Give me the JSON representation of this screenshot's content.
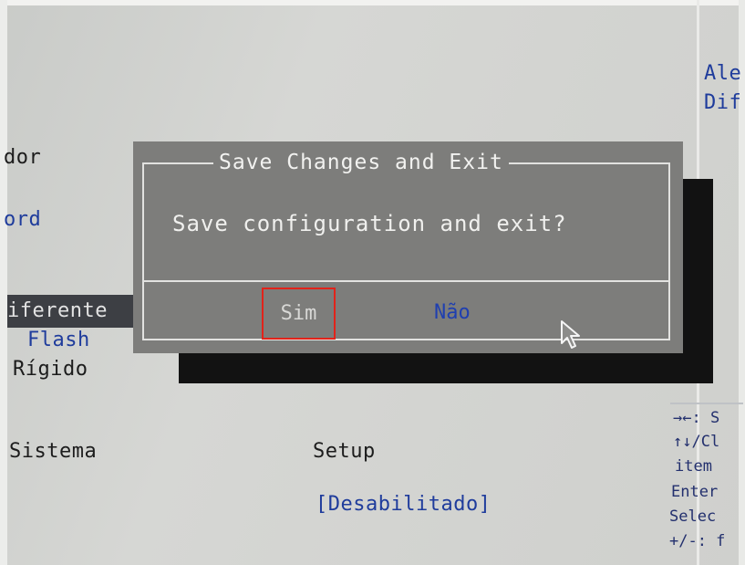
{
  "background": {
    "labels": [
      "dor",
      "ord",
      "iferente",
      "Flash",
      "Rígido",
      "Sistema",
      "Setup",
      "[Desabilitado]"
    ],
    "right_column_top": [
      "Ale",
      "Dif"
    ]
  },
  "help_panel": {
    "lines": [
      "→←: S",
      "↑↓/Cl",
      "item",
      "Enter",
      "Selec",
      "+/-: f"
    ]
  },
  "dialog": {
    "title": "Save Changes and Exit",
    "message": "Save configuration and exit?",
    "yes_label": "Sim",
    "no_label": "Não"
  },
  "colors": {
    "dialog_bg": "#7d7d7b",
    "highlight_border": "#e2231a",
    "no_text": "#1f3fb0",
    "selected_row_bg": "#3d3f44"
  },
  "icons": {
    "cursor": "mouse-pointer-icon"
  }
}
